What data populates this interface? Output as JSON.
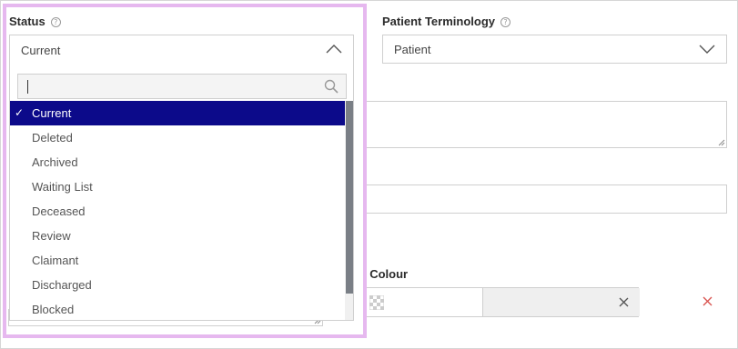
{
  "status": {
    "label": "Status",
    "help_icon": "help-circle-icon",
    "value": "Current",
    "search_placeholder": "",
    "options": [
      {
        "label": "Current",
        "selected": true
      },
      {
        "label": "Deleted",
        "selected": false
      },
      {
        "label": "Archived",
        "selected": false
      },
      {
        "label": "Waiting List",
        "selected": false
      },
      {
        "label": "Deceased",
        "selected": false
      },
      {
        "label": "Review",
        "selected": false
      },
      {
        "label": "Claimant",
        "selected": false
      },
      {
        "label": "Discharged",
        "selected": false
      },
      {
        "label": "Blocked",
        "selected": false
      }
    ]
  },
  "patient_terminology": {
    "label": "Patient Terminology",
    "help_icon": "help-circle-icon",
    "value": "Patient"
  },
  "alert_colour": {
    "label": "ert Colour",
    "swatch_icon": "transparent-swatch-icon",
    "clear_icon": "close-icon",
    "remove_icon": "close-icon"
  },
  "colors": {
    "selected_bg": "#0c0a8a",
    "highlight_border": "#e6b8ef",
    "remove_icon": "#d9534f"
  }
}
